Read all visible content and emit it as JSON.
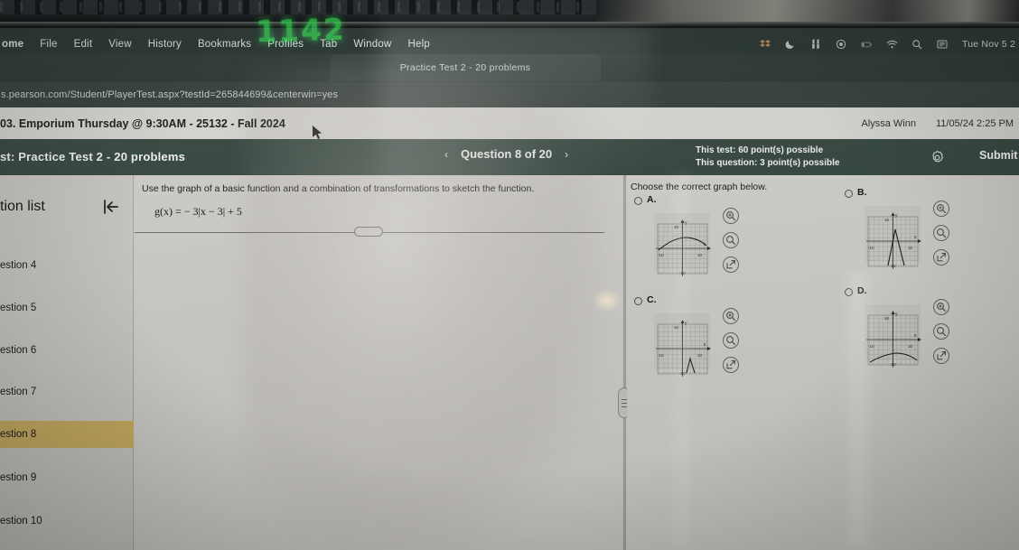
{
  "desktop": {
    "menubar": {
      "items": [
        "ome",
        "File",
        "Edit",
        "View",
        "History",
        "Bookmarks",
        "Profiles",
        "Tab",
        "Window",
        "Help"
      ],
      "status_icons": [
        "dropbox-icon",
        "do-not-disturb-moon-icon",
        "music-icon",
        "screen-record-icon",
        "battery-icon",
        "wifi-icon",
        "spotlight-search-icon",
        "control-center-icon"
      ],
      "clock": "Tue Nov 5  2"
    },
    "neon_sign_reflection": "1142"
  },
  "browser": {
    "tab_title": "Practice Test 2 - 20 problems",
    "url": "s.pearson.com/Student/PlayerTest.aspx?testId=265844699&centerwin=yes"
  },
  "course_bar": {
    "course": "03. Emporium Thursday @ 9:30AM - 25132 - Fall 2024",
    "student_name": "Alyssa Winn",
    "timestamp": "11/05/24 2:25 PM"
  },
  "app_header": {
    "title": "st: Practice Test 2 - 20 problems",
    "prev_label": "‹",
    "question_counter": "Question 8 of 20",
    "next_label": "›",
    "test_points": "This test: 60 point(s) possible",
    "question_points": "This question: 3 point(s) possible",
    "gear_icon": "gear-icon",
    "submit_label": "Submit",
    "accent_green": "#35463f"
  },
  "sidebar": {
    "title": "tion list",
    "collapse_icon": "collapse-panel-icon",
    "highlight_color": "#c9ae63",
    "items": [
      {
        "label": "estion 4",
        "active": false
      },
      {
        "label": "estion 5",
        "active": false
      },
      {
        "label": "estion 6",
        "active": false
      },
      {
        "label": "estion 7",
        "active": false
      },
      {
        "label": "estion 8",
        "active": true
      },
      {
        "label": "estion 9",
        "active": false
      },
      {
        "label": "estion 10",
        "active": false
      }
    ]
  },
  "problem": {
    "prompt": "Use the graph of a basic function and a combination of transformations to sketch the function.",
    "formula": "g(x) = − 3|x − 3| + 5"
  },
  "answers": {
    "instruction": "Choose the correct graph below.",
    "tool_icons": [
      "zoom-in-icon",
      "zoom-out-icon",
      "expand-graph-icon"
    ],
    "choices": [
      {
        "letter": "A.",
        "selected": false,
        "graph": "wide downward arch opening below x-axis, vertex near upper middle"
      },
      {
        "letter": "B.",
        "selected": false,
        "graph": "narrow upward spike with steep sides near origin"
      },
      {
        "letter": "C.",
        "selected": false,
        "graph": "small narrow upward spike at lower right of grid"
      },
      {
        "letter": "D.",
        "selected": false,
        "graph": "shallow rising arch along the bottom of the grid"
      }
    ]
  },
  "graph_axes": {
    "x_label": "x",
    "y_label": "y",
    "tick_top": "10",
    "tick_left": "-10",
    "tick_right": "10",
    "tick_bottom": "-10"
  }
}
